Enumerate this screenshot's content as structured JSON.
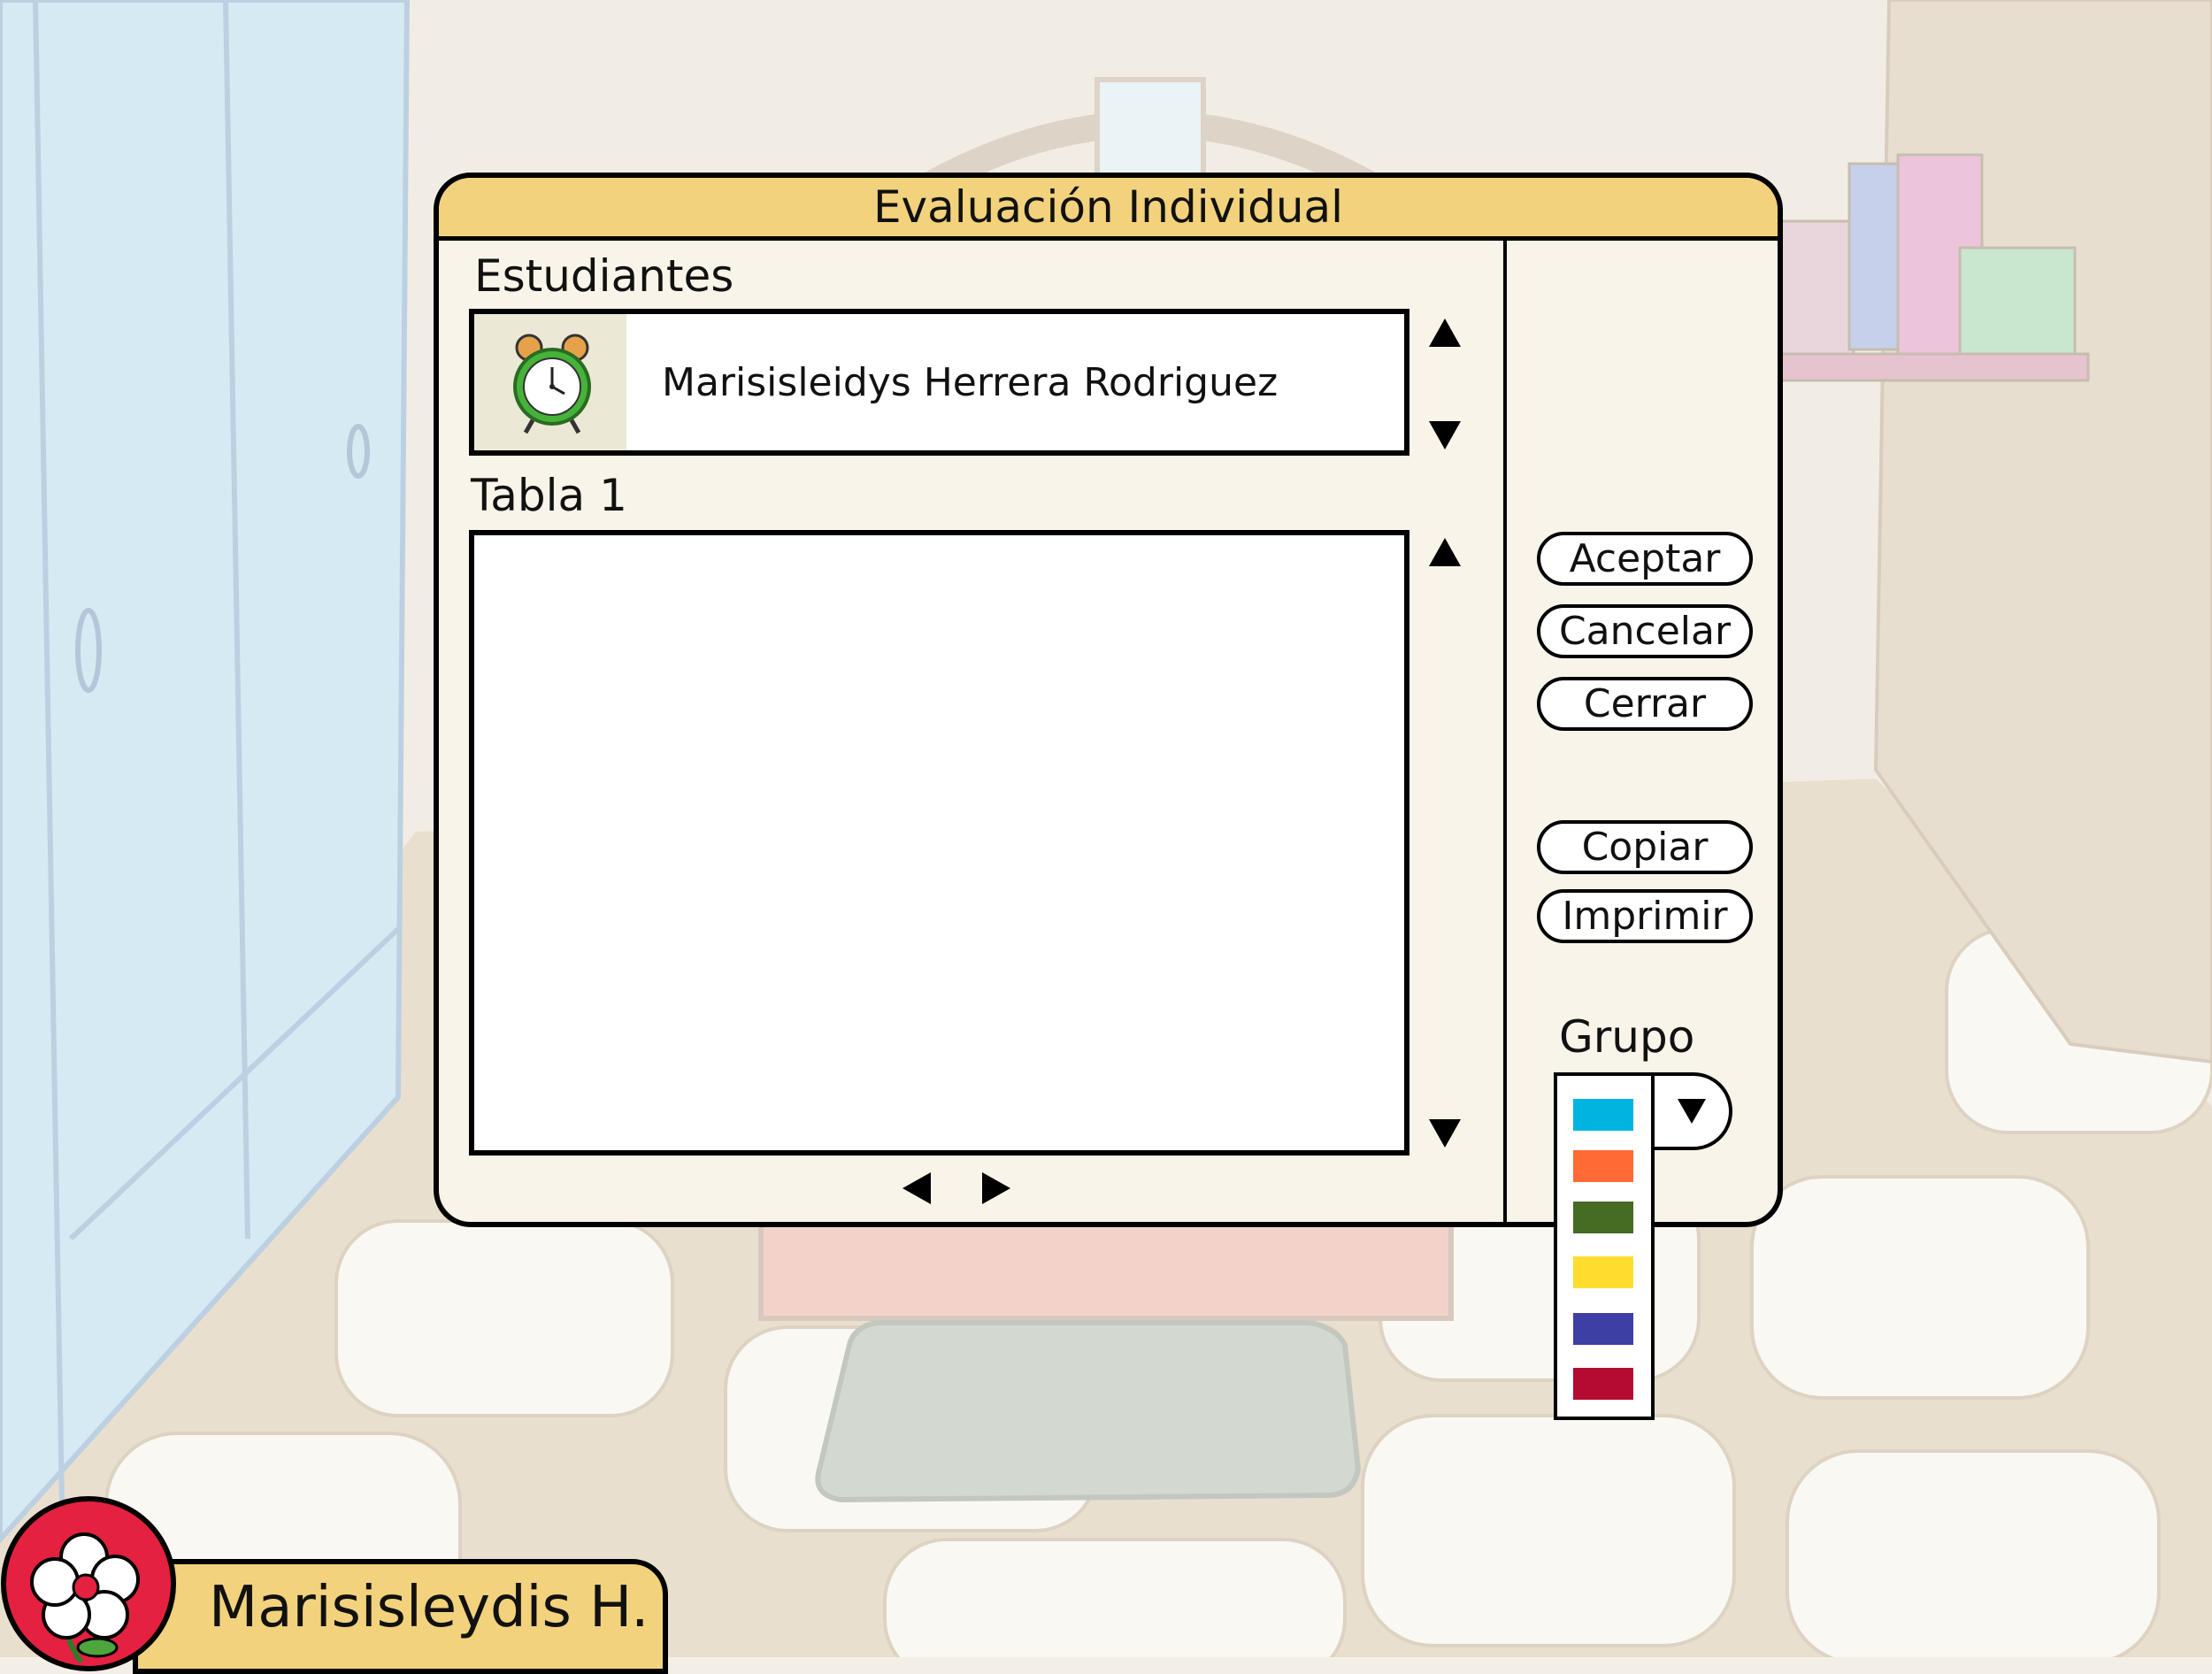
{
  "dialog": {
    "title": "Evaluación Individual",
    "students_label": "Estudiantes",
    "student_name": "Marisisleidys Herrera Rodriguez",
    "student_icon": "alarm-clock-icon",
    "table_label": "Tabla 1"
  },
  "buttons": {
    "accept": "Aceptar",
    "cancel": "Cancelar",
    "close": "Cerrar",
    "copy": "Copiar",
    "print": "Imprimir"
  },
  "group": {
    "label": "Grupo",
    "colors": [
      "#00b4e0",
      "#ff6a35",
      "#466b22",
      "#ffdd2e",
      "#3e3fa4",
      "#b50a32"
    ]
  },
  "user": {
    "name": "Marisisleydis H.",
    "avatar_icon": "flower-icon"
  },
  "theme": {
    "titlebar": "#f2d27c",
    "panel": "#f9f4e9",
    "avatar_bg": "#e52141"
  }
}
